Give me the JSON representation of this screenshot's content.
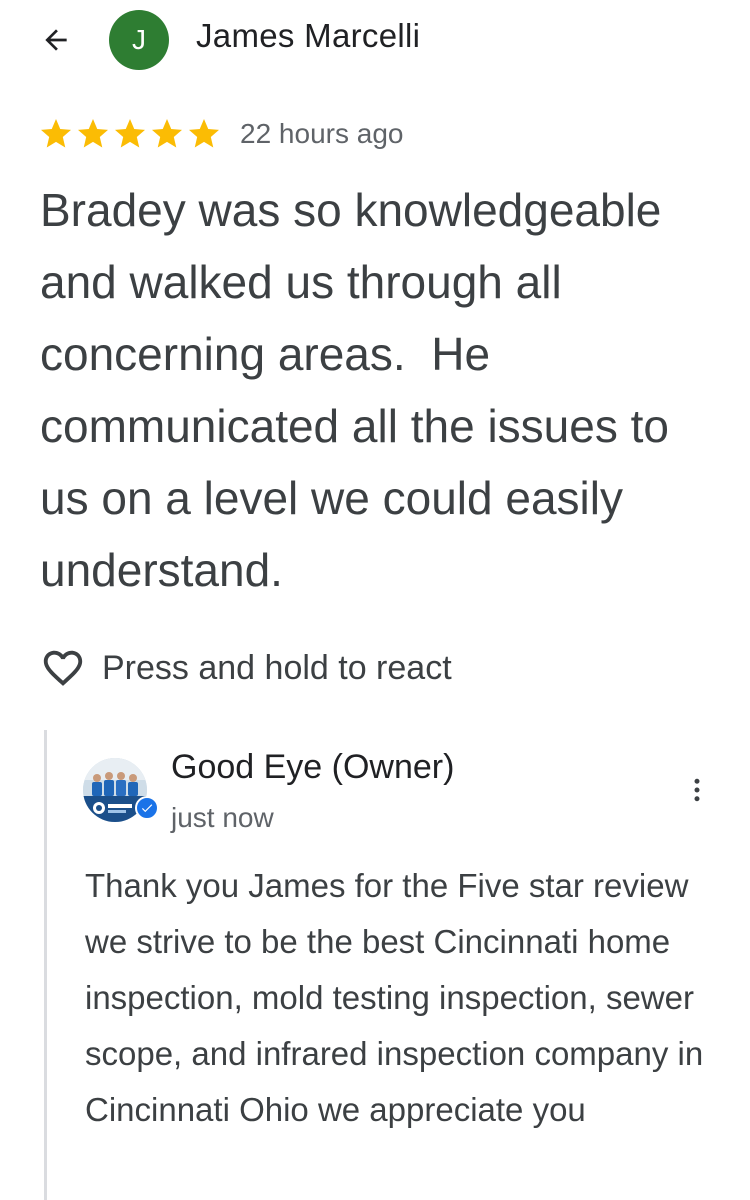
{
  "header": {
    "back_icon": "arrow-left-icon",
    "avatar_initial": "J",
    "avatar_color": "#2e7d32",
    "reviewer_name": "James Marcelli"
  },
  "review": {
    "rating": 5,
    "star_color": "#fbbc04",
    "time_ago": "22 hours ago",
    "text": "Bradey was so knowledgeable and walked us through all concerning areas.  He communicated all the issues to us on a level we could easily understand."
  },
  "react": {
    "icon": "heart-outline-icon",
    "label": "Press and hold to react"
  },
  "owner_reply": {
    "name": "Good Eye (Owner)",
    "time": "just now",
    "verified_color": "#1a73e8",
    "more_icon": "more-vert-icon",
    "text": "Thank you James for the Five star review we strive to be the best Cincinnati home inspection, mold testing inspection, sewer scope, and infrared inspection company in Cincinnati Ohio we appreciate you"
  }
}
